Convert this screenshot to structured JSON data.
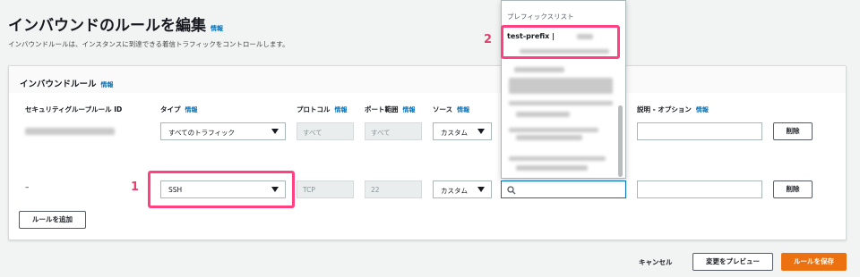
{
  "page": {
    "title": "インバウンドのルールを編集",
    "info": "情報",
    "description": "インバウンドルールは、インスタンスに到達できる着信トラフィックをコントロールします。"
  },
  "panel": {
    "title": "インバウンドルール",
    "info": "情報"
  },
  "columns": {
    "sg_rule_id": "セキュリティグループルール ID",
    "type": "タイプ",
    "protocol": "プロトコル",
    "port_range": "ポート範囲",
    "source": "ソース",
    "description": "説明 - オプション",
    "info": "情報"
  },
  "rows": [
    {
      "rule_id": "",
      "type": "すべてのトラフィック",
      "protocol": "すべて",
      "port_range": "すべて",
      "source": "カスタム",
      "delete": "削除"
    },
    {
      "rule_id": "–",
      "type": "SSH",
      "protocol": "TCP",
      "port_range": "22",
      "source": "カスタム",
      "delete": "削除"
    }
  ],
  "add_rule_label": "ルールを追加",
  "dropdown": {
    "group_label": "プレフィックスリスト",
    "first_item": "test-prefix |"
  },
  "footer": {
    "cancel": "キャンセル",
    "preview": "変更をプレビュー",
    "save": "ルールを保存"
  },
  "annotations": {
    "callout1": "1",
    "callout2": "2",
    "highlight_color": "#ff4081"
  },
  "colors": {
    "accent": "#ec7211",
    "link": "#0073bb"
  }
}
